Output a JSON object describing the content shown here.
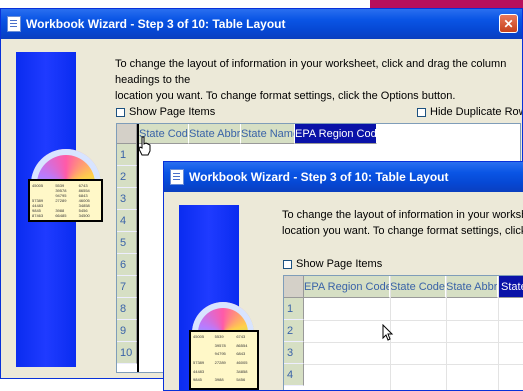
{
  "back_window": {
    "title": "Workbook Wizard - Step 3 of 10: Table Layout",
    "instructions_line1": "To change the layout of information in your worksheet, click and drag the column headings to the",
    "instructions_line2": "location you want.  To change format settings, click the Options button.",
    "show_page_items": "Show Page Items",
    "hide_duplicate_rows": "Hide Duplicate Rows",
    "columns": [
      "State Code",
      "State Abbr",
      "State Name",
      "EPA Region Code"
    ],
    "selected_column": "EPA Region Code",
    "rows": [
      "1",
      "2",
      "3",
      "4",
      "5",
      "6",
      "7",
      "8",
      "9",
      "10"
    ]
  },
  "front_window": {
    "title": "Workbook Wizard - Step 3 of 10: Table Layout",
    "instructions_line1": "To change the layout of information in your worksheet, click and drag the column headings to the",
    "instructions_line2": "location you want.  To change format settings, click the Options button.",
    "show_page_items": "Show Page Items",
    "columns": [
      "EPA Region Code",
      "State Code",
      "State Abbr",
      "State"
    ],
    "selected_column": "State",
    "rows": [
      "1",
      "2",
      "3",
      "4"
    ]
  },
  "sheet_numbers": [
    "45005",
    "5539",
    "6743",
    "",
    "39578",
    "86554",
    "",
    "94795",
    "6843",
    "57389",
    "27289",
    "46005",
    "44483",
    "",
    "34858",
    "9845",
    "3988",
    "5456",
    "87463",
    "66485",
    "34500"
  ],
  "colors": {
    "title_bar": "#0a55e5",
    "header_bg": "#d6dfc4",
    "selected_header": "#0a12a8",
    "side_panel": "#1f3bff"
  },
  "icons": [
    "app-icon",
    "close-icon",
    "cd-graphic",
    "hand-cursor-icon",
    "arrow-cursor-icon"
  ]
}
